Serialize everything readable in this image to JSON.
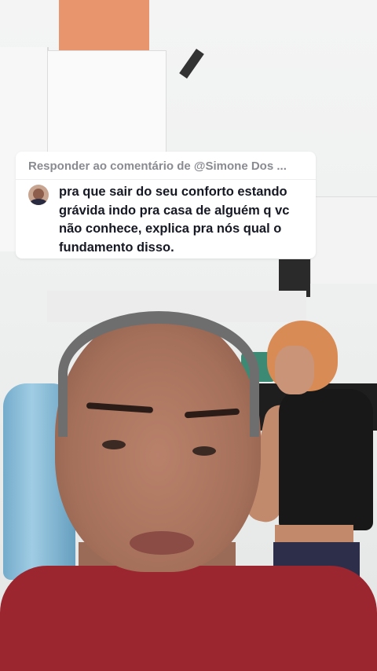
{
  "reply": {
    "header": "Responder ao comentário de @Simone Dos ...",
    "comment": "pra que sair do seu conforto estando grávida indo pra casa de alguém q vc não conhece, explica pra nós qual o fundamento disso."
  },
  "colors": {
    "card_background": "#ffffff",
    "header_text": "#8a8b91",
    "comment_text": "#161823",
    "shirt": "#9c2630"
  }
}
